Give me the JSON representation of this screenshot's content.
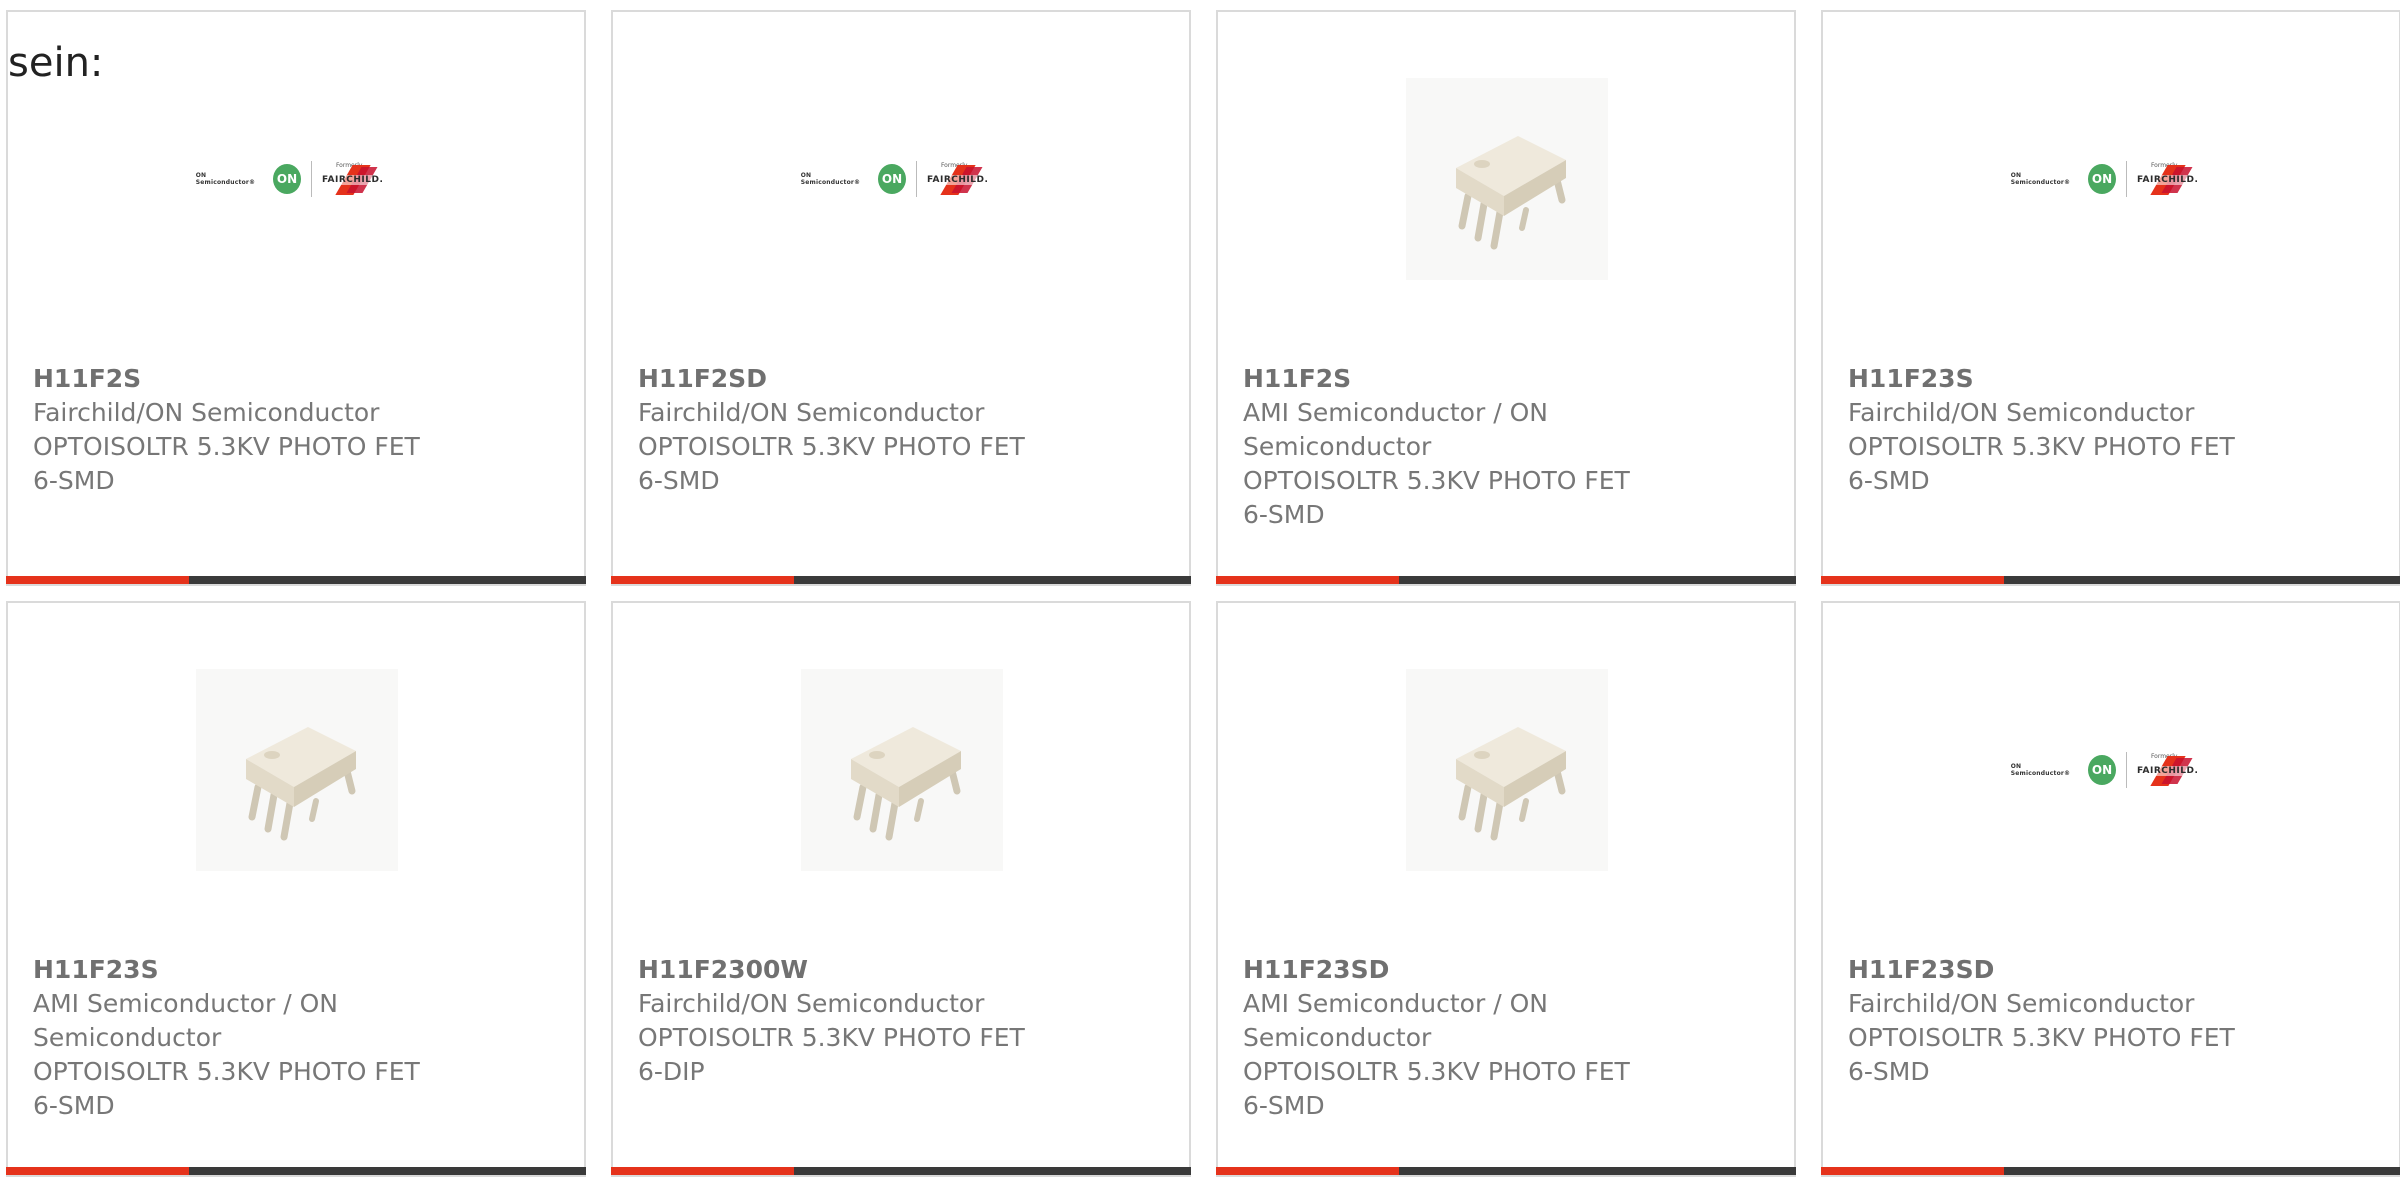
{
  "intro": "sein:",
  "cards": [
    {
      "part": "H11F2S",
      "manufacturer": [
        "Fairchild/ON Semiconductor"
      ],
      "description": "OPTOISOLTR 5.3KV PHOTO FET",
      "package": "6-SMD",
      "image": "on-fairchild-logo",
      "logo": {
        "on_text": "ON Semiconductor®",
        "on_badge": "ON",
        "formerly": "Formerly",
        "fairchild": "FAIRCHILD."
      }
    },
    {
      "part": "H11F2SD",
      "manufacturer": [
        "Fairchild/ON Semiconductor"
      ],
      "description": "OPTOISOLTR 5.3KV PHOTO FET",
      "package": "6-SMD",
      "image": "on-fairchild-logo",
      "logo": {
        "on_text": "ON Semiconductor®",
        "on_badge": "ON",
        "formerly": "Formerly",
        "fairchild": "FAIRCHILD."
      }
    },
    {
      "part": "H11F2S",
      "manufacturer": [
        "AMI Semiconductor / ON",
        "Semiconductor"
      ],
      "description": "OPTOISOLTR 5.3KV PHOTO FET",
      "package": "6-SMD",
      "image": "dip6-chip"
    },
    {
      "part": "H11F23S",
      "manufacturer": [
        "Fairchild/ON Semiconductor"
      ],
      "description": "OPTOISOLTR 5.3KV PHOTO FET",
      "package": "6-SMD",
      "image": "on-fairchild-logo",
      "logo": {
        "on_text": "ON Semiconductor®",
        "on_badge": "ON",
        "formerly": "Formerly",
        "fairchild": "FAIRCHILD."
      }
    },
    {
      "part": "H11F23S",
      "manufacturer": [
        "AMI Semiconductor / ON",
        "Semiconductor"
      ],
      "description": "OPTOISOLTR 5.3KV PHOTO FET",
      "package": "6-SMD",
      "image": "dip6-chip"
    },
    {
      "part": "H11F2300W",
      "manufacturer": [
        "Fairchild/ON Semiconductor"
      ],
      "description": "OPTOISOLTR 5.3KV PHOTO FET",
      "package": "6-DIP",
      "image": "dip6-chip"
    },
    {
      "part": "H11F23SD",
      "manufacturer": [
        "AMI Semiconductor / ON",
        "Semiconductor"
      ],
      "description": "OPTOISOLTR 5.3KV PHOTO FET",
      "package": "6-SMD",
      "image": "dip6-chip"
    },
    {
      "part": "H11F23SD",
      "manufacturer": [
        "Fairchild/ON Semiconductor"
      ],
      "description": "OPTOISOLTR 5.3KV PHOTO FET",
      "package": "6-SMD",
      "image": "on-fairchild-logo",
      "logo": {
        "on_text": "ON Semiconductor®",
        "on_badge": "ON",
        "formerly": "Formerly",
        "fairchild": "FAIRCHILD."
      }
    }
  ],
  "colors": {
    "accent": "#e5321b",
    "bar": "#3a3a3a",
    "border": "#dadada",
    "text": "#777777"
  }
}
